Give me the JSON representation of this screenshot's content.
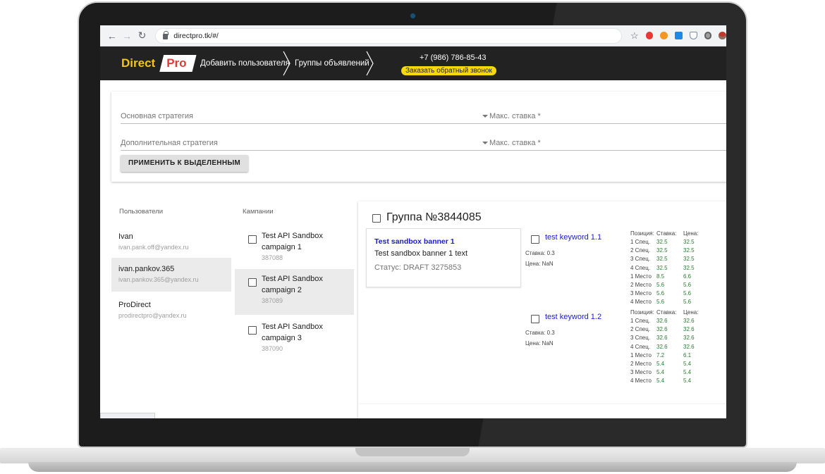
{
  "browser": {
    "url": "directpro.tk/#/"
  },
  "header": {
    "logo_direct": "Direct",
    "logo_pro": "Pro",
    "nav_add_user": "Добавить пользователя",
    "nav_groups": "Группы объявлений",
    "phone": "+7 (986) 786-85-43",
    "callback": "Заказать обратный звонок"
  },
  "strategy": {
    "main_label": "Основная стратегия",
    "extra_label": "Дополнительная стратегия",
    "max_bid_label": "Макс. ставка *",
    "apply_button": "ПРИМЕНИТЬ К ВЫДЕЛЕННЫМ"
  },
  "users": {
    "title": "Пользователи",
    "items": [
      {
        "name": "Ivan",
        "email": "ivan.pank.off@yandex.ru"
      },
      {
        "name": "ivan.pankov.365",
        "email": "ivan.pankov.365@yandex.ru"
      },
      {
        "name": "ProDirect",
        "email": "prodirectpro@yandex.ru"
      }
    ]
  },
  "campaigns": {
    "title": "Кампании",
    "items": [
      {
        "name": "Test API Sandbox campaign 1",
        "id": "387088"
      },
      {
        "name": "Test API Sandbox campaign 2",
        "id": "387089"
      },
      {
        "name": "Test API Sandbox campaign 3",
        "id": "387090"
      }
    ]
  },
  "group": {
    "title": "Группа №3844085",
    "banner": {
      "title": "Test sandbox banner 1",
      "text": "Test sandbox banner 1 text",
      "status": "Статус: DRAFT 3275853"
    },
    "bid_headers": {
      "position": "Позиция:",
      "bid": "Ставка:",
      "price": "Цена:"
    },
    "keywords": [
      {
        "name": "test keyword 1.1",
        "bid": "Ставка: 0.3",
        "price": "Цена: NaN",
        "rows": [
          [
            "1 Спец.",
            "32.5",
            "32.5"
          ],
          [
            "2 Спец.",
            "32.5",
            "32.5"
          ],
          [
            "3 Спец.",
            "32.5",
            "32.5"
          ],
          [
            "4 Спец.",
            "32.5",
            "32.5"
          ],
          [
            "1 Место",
            "8.5",
            "6.6"
          ],
          [
            "2 Место",
            "5.6",
            "5.6"
          ],
          [
            "3 Место",
            "5.6",
            "5.6"
          ],
          [
            "4 Место",
            "5.6",
            "5.6"
          ]
        ]
      },
      {
        "name": "test keyword 1.2",
        "bid": "Ставка: 0.3",
        "price": "Цена: NaN",
        "rows": [
          [
            "1 Спец.",
            "32.6",
            "32.6"
          ],
          [
            "2 Спец.",
            "32.6",
            "32.6"
          ],
          [
            "3 Спец.",
            "32.6",
            "32.6"
          ],
          [
            "4 Спец.",
            "32.6",
            "32.6"
          ],
          [
            "1 Место",
            "7.2",
            "6.1"
          ],
          [
            "2 Место",
            "5.4",
            "5.4"
          ],
          [
            "3 Место",
            "5.4",
            "5.4"
          ],
          [
            "4 Место",
            "5.4",
            "5.4"
          ]
        ]
      }
    ]
  }
}
